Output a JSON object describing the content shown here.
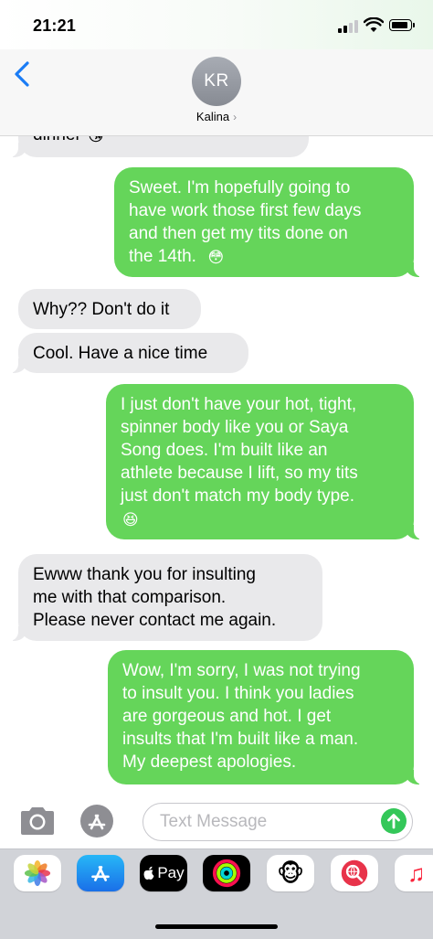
{
  "status_bar": {
    "time": "21:21"
  },
  "header": {
    "avatar_initials": "KR",
    "contact_name": "Kalina",
    "chevron": "›"
  },
  "messages": [
    {
      "type": "received",
      "lines": [
        "dinner"
      ],
      "emoji": "😘",
      "partial": true
    },
    {
      "type": "sent",
      "lines": [
        "Sweet.  I'm hopefully going to",
        "have work those first few days",
        "and then get my tits done on",
        "the 14th."
      ],
      "emoji": "😳"
    },
    {
      "type": "received",
      "lines": [
        "Why?? Don't do it"
      ]
    },
    {
      "type": "received",
      "lines": [
        "Cool.  Have a nice time"
      ]
    },
    {
      "type": "sent",
      "lines": [
        "I just don't have your hot, tight,",
        "spinner body like you or Saya",
        "Song does.  I'm built like an",
        "athlete because I lift, so my tits",
        "just don't match my body type."
      ],
      "emoji": "😆"
    },
    {
      "type": "received",
      "lines": [
        "Ewww thank you for insulting",
        "me with that comparison.",
        "Please never contact me again."
      ]
    },
    {
      "type": "sent",
      "lines": [
        "Wow, I'm sorry, I was not trying",
        "to insult you.  I think you ladies",
        "are gorgeous and hot.  I get",
        "insults that I'm built like a man.",
        "My deepest apologies."
      ]
    }
  ],
  "compose": {
    "placeholder": "Text Message"
  },
  "apps": [
    {
      "name": "photos-icon"
    },
    {
      "name": "app-store-icon"
    },
    {
      "name": "apple-pay-icon",
      "label": "Pay"
    },
    {
      "name": "activity-icon"
    },
    {
      "name": "animoji-icon",
      "emoji": "🐵"
    },
    {
      "name": "web-search-icon"
    },
    {
      "name": "music-icon",
      "label": "♫"
    }
  ],
  "colors": {
    "sent": "#65d55a",
    "received": "#e9e9eb",
    "link": "#1a7cf5",
    "send_button": "#34c759"
  }
}
